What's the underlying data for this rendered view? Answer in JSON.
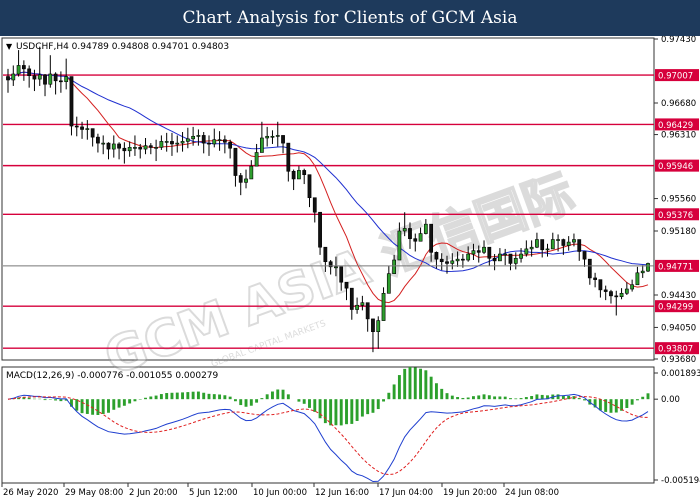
{
  "banner": {
    "title": "Chart Analysis for Clients of GCM Asia"
  },
  "watermark": {
    "text": "GCM ASIA 汇信国际",
    "subtext": "GLOBAL CAPITAL MARKETS"
  },
  "chart_data": [
    {
      "type": "candlestick",
      "symbol_info": "USDCHF,H4 0.94789 0.94808 0.94701 0.94803",
      "ylim": [
        0.9368,
        0.9743
      ],
      "yticks": [
        "0.97430",
        "0.96680",
        "0.96310",
        "0.95560",
        "0.95180",
        "0.94430",
        "0.94050",
        "0.93680"
      ],
      "xticks": [
        "26 May 2020",
        "29 May 08:00",
        "2 Jun 20:00",
        "5 Jun 12:00",
        "10 Jun 00:00",
        "12 Jun 16:00",
        "17 Jun 04:00",
        "19 Jun 20:00",
        "24 Jun 08:00"
      ],
      "levels": [
        "0.97007",
        "0.96429",
        "0.95946",
        "0.95376",
        "0.94299",
        "0.93807"
      ],
      "current_price": "0.94771",
      "close": [
        0.9695,
        0.9702,
        0.9712,
        0.9708,
        0.97,
        0.9696,
        0.9701,
        0.969,
        0.9702,
        0.9694,
        0.9693,
        0.9699,
        0.9641,
        0.964,
        0.9637,
        0.9638,
        0.9628,
        0.9621,
        0.9621,
        0.9614,
        0.962,
        0.9615,
        0.9612,
        0.9616,
        0.9616,
        0.9614,
        0.9618,
        0.9616,
        0.9616,
        0.9623,
        0.9623,
        0.962,
        0.9621,
        0.9623,
        0.9626,
        0.9629,
        0.963,
        0.9621,
        0.962,
        0.9625,
        0.9625,
        0.9622,
        0.9615,
        0.9583,
        0.9575,
        0.9579,
        0.9594,
        0.961,
        0.9627,
        0.9629,
        0.9629,
        0.963,
        0.9621,
        0.9588,
        0.9579,
        0.9589,
        0.9584,
        0.9557,
        0.954,
        0.9499,
        0.9482,
        0.9476,
        0.9476,
        0.9458,
        0.9451,
        0.9426,
        0.9431,
        0.9434,
        0.9415,
        0.94,
        0.9413,
        0.9445,
        0.9468,
        0.9484,
        0.9518,
        0.9521,
        0.9509,
        0.9506,
        0.9515,
        0.9526,
        0.9493,
        0.9485,
        0.9482,
        0.948,
        0.9483,
        0.9485,
        0.9484,
        0.9491,
        0.9495,
        0.9493,
        0.9499,
        0.9486,
        0.9483,
        0.9491,
        0.9491,
        0.948,
        0.9486,
        0.9491,
        0.9497,
        0.9499,
        0.9508,
        0.9496,
        0.9497,
        0.9508,
        0.9508,
        0.9501,
        0.9505,
        0.9508,
        0.9494,
        0.9485,
        0.9463,
        0.9461,
        0.9449,
        0.9447,
        0.9442,
        0.9441,
        0.9445,
        0.945,
        0.9455,
        0.9469,
        0.9471,
        0.948
      ],
      "high": [
        0.9708,
        0.9712,
        0.973,
        0.9718,
        0.9712,
        0.9707,
        0.9734,
        0.9702,
        0.9724,
        0.9704,
        0.9705,
        0.972,
        0.9664,
        0.9652,
        0.9646,
        0.9648,
        0.9636,
        0.9632,
        0.963,
        0.9622,
        0.963,
        0.9622,
        0.9622,
        0.9623,
        0.963,
        0.962,
        0.9627,
        0.9621,
        0.9625,
        0.963,
        0.9633,
        0.9633,
        0.963,
        0.9634,
        0.9639,
        0.964,
        0.9637,
        0.9634,
        0.963,
        0.9638,
        0.9635,
        0.963,
        0.9625,
        0.9591,
        0.9586,
        0.959,
        0.9601,
        0.962,
        0.9646,
        0.964,
        0.9636,
        0.9646,
        0.963,
        0.9598,
        0.959,
        0.9594,
        0.9591,
        0.9565,
        0.955,
        0.9508,
        0.9492,
        0.9484,
        0.9488,
        0.9468,
        0.9458,
        0.9436,
        0.944,
        0.9442,
        0.9424,
        0.9412,
        0.9418,
        0.9452,
        0.9477,
        0.949,
        0.9528,
        0.954,
        0.9528,
        0.9515,
        0.9522,
        0.9532,
        0.9502,
        0.9494,
        0.9492,
        0.9489,
        0.9492,
        0.9494,
        0.9491,
        0.95,
        0.9503,
        0.9501,
        0.9507,
        0.9496,
        0.9491,
        0.9498,
        0.9497,
        0.9489,
        0.9493,
        0.9498,
        0.9507,
        0.9507,
        0.9516,
        0.9503,
        0.9503,
        0.9516,
        0.9514,
        0.9509,
        0.9512,
        0.9515,
        0.9501,
        0.9494,
        0.9472,
        0.9469,
        0.9456,
        0.9454,
        0.9449,
        0.9448,
        0.9451,
        0.9458,
        0.9461,
        0.9476,
        0.9478,
        0.9481
      ],
      "low": [
        0.968,
        0.9688,
        0.9699,
        0.9694,
        0.9686,
        0.9682,
        0.9688,
        0.9676,
        0.9686,
        0.9678,
        0.968,
        0.9684,
        0.963,
        0.9629,
        0.9626,
        0.9625,
        0.9617,
        0.961,
        0.9608,
        0.9602,
        0.9604,
        0.9602,
        0.9597,
        0.9605,
        0.9606,
        0.9603,
        0.9608,
        0.9608,
        0.96,
        0.9613,
        0.9611,
        0.9606,
        0.961,
        0.9611,
        0.9615,
        0.9618,
        0.9618,
        0.9609,
        0.9606,
        0.9616,
        0.9612,
        0.9609,
        0.9603,
        0.957,
        0.956,
        0.9568,
        0.9582,
        0.96,
        0.9617,
        0.9617,
        0.962,
        0.9617,
        0.9609,
        0.9576,
        0.9566,
        0.958,
        0.9573,
        0.9546,
        0.9528,
        0.949,
        0.947,
        0.9467,
        0.9465,
        0.9448,
        0.9437,
        0.9414,
        0.9421,
        0.9425,
        0.94,
        0.9376,
        0.938,
        0.9436,
        0.9456,
        0.9474,
        0.9504,
        0.9512,
        0.9497,
        0.9494,
        0.9508,
        0.9514,
        0.9482,
        0.9474,
        0.9472,
        0.9468,
        0.9473,
        0.9476,
        0.9475,
        0.9482,
        0.9484,
        0.9481,
        0.9491,
        0.9477,
        0.9472,
        0.9483,
        0.9478,
        0.9472,
        0.9473,
        0.9481,
        0.9488,
        0.9488,
        0.9498,
        0.9487,
        0.9488,
        0.9499,
        0.9494,
        0.949,
        0.9495,
        0.95,
        0.9483,
        0.9476,
        0.9455,
        0.9452,
        0.944,
        0.9437,
        0.9433,
        0.9419,
        0.9438,
        0.9443,
        0.9447,
        0.9461,
        0.9463,
        0.947
      ]
    },
    {
      "type": "macd",
      "label": "MACD(12,26,9) -0.000776 -0.001055 0.000279",
      "ylim": [
        -0.005194,
        0.001893
      ],
      "yticks": [
        "0.001893",
        "0.00",
        "-0.005194"
      ]
    }
  ],
  "colors": {
    "bull": "#2e9e2e",
    "bear": "#111111",
    "ma_fast": "#d42020",
    "ma_slow": "#2030d0",
    "level": "#d6003c",
    "current": "#d6003c",
    "macd_hist": "#2ca02c",
    "macd_main": "#1f3fcf",
    "macd_signal": "#e02020"
  }
}
